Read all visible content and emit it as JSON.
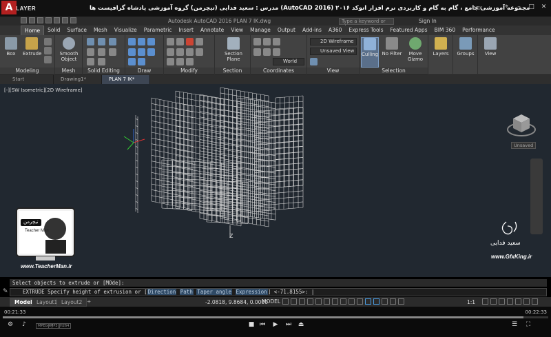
{
  "player": {
    "name": "KMPLAYER",
    "video_title": "مجموعه آموزشی جامع ، گام به گام و کاربردی نرم افزار اتوکد ۲۰۱۶ (AutoCAD 2016) مدرس : سعید فدایی (تیچرمن) گروه آموزشی پادشاه گرافیست ها",
    "box_label": "BOX",
    "time_elapsed": "00:21:33",
    "time_total": "00:22:33",
    "progress": 0.955,
    "badges": [
      "MPEG4",
      "MP3",
      "H264"
    ]
  },
  "acad": {
    "logo": "A",
    "file_title": "Autodesk AutoCAD 2016   PLAN 7 IK.dwg",
    "search_placeholder": "Type a keyword or phrase",
    "signin": "Sign In"
  },
  "ribbon_tabs": [
    "Home",
    "Solid",
    "Surface",
    "Mesh",
    "Visualize",
    "Parametric",
    "Insert",
    "Annotate",
    "View",
    "Manage",
    "Output",
    "Add-ins",
    "A360",
    "Express Tools",
    "Featured Apps",
    "BIM 360",
    "Performance"
  ],
  "ribbon": {
    "box": "Box",
    "extrude": "Extrude",
    "smooth": "Smooth Object",
    "section_plane": "Section Plane",
    "culling": "Culling",
    "no_filter": "No Filter",
    "move_gizmo": "Move Gizmo",
    "layers": "Layers",
    "groups": "Groups",
    "view": "View",
    "visual_style": "2D Wireframe",
    "saved_view": "Unsaved View",
    "ucs": "World",
    "groups_labels": {
      "modeling": "Modeling",
      "mesh": "Mesh",
      "solid_editing": "Solid Editing",
      "draw": "Draw",
      "modify": "Modify",
      "section": "Section",
      "coordinates": "Coordinates",
      "view": "View",
      "selection": "Selection"
    }
  },
  "doc_tabs": [
    "Start",
    "Drawing1*",
    "PLAN 7 IK*"
  ],
  "viewport": {
    "label": "[-][SW Isometric][2D Wireframe]",
    "viewcube_label": "Unsaved",
    "z_axis": "Z"
  },
  "watermark": {
    "teacher_badge": "تیچرمن",
    "teacher_sub": "Teacher Man",
    "teacher_url": "www.TeacherMan.ir",
    "gfx_name": "سعید فدایی",
    "gfx_url": "www.GfxKing.ir"
  },
  "command": {
    "history": "Select objects to extrude or [MOde]:",
    "prompt_prefix": "EXTRUDE Specify height of extrusion or [",
    "options": [
      "Direction",
      "Path",
      "Taper angle",
      "Expression"
    ],
    "prompt_suffix": "] <-71.8155>:"
  },
  "status": {
    "layouts": [
      "Model",
      "Layout1",
      "Layout2"
    ],
    "add_layout": "+",
    "coords": "-2.0818, 9.8684, 0.0000",
    "model": "MODEL",
    "scale": "1:1"
  }
}
